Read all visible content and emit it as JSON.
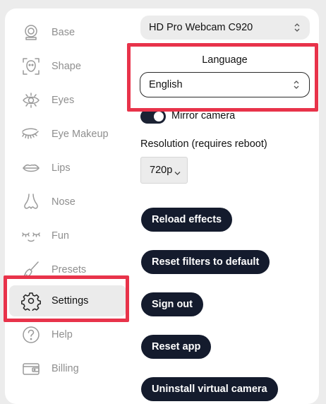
{
  "sidebar": {
    "items": [
      {
        "label": "Base",
        "icon": "webcam-icon"
      },
      {
        "label": "Shape",
        "icon": "face-shape-icon"
      },
      {
        "label": "Eyes",
        "icon": "eye-icon"
      },
      {
        "label": "Eye Makeup",
        "icon": "eyelashes-icon"
      },
      {
        "label": "Lips",
        "icon": "lips-icon"
      },
      {
        "label": "Nose",
        "icon": "nose-icon"
      },
      {
        "label": "Fun",
        "icon": "closed-eyes-icon"
      },
      {
        "label": "Presets",
        "icon": "brush-icon"
      },
      {
        "label": "Settings",
        "icon": "gear-icon"
      },
      {
        "label": "Help",
        "icon": "question-icon"
      },
      {
        "label": "Billing",
        "icon": "wallet-icon"
      }
    ],
    "active": "Settings"
  },
  "settings": {
    "camera_value": "HD Pro Webcam C920",
    "language_label": "Language",
    "language_value": "English",
    "mirror_label": "Mirror camera",
    "mirror_on": true,
    "resolution_label": "Resolution (requires reboot)",
    "resolution_value": "720p",
    "buttons": {
      "reload": "Reload effects",
      "reset_filters": "Reset filters to default",
      "sign_out": "Sign out",
      "reset_app": "Reset app",
      "uninstall": "Uninstall virtual camera"
    }
  },
  "colors": {
    "highlight": "#e8334a",
    "button_bg": "#141b2d",
    "active_bg": "#ebebeb"
  }
}
